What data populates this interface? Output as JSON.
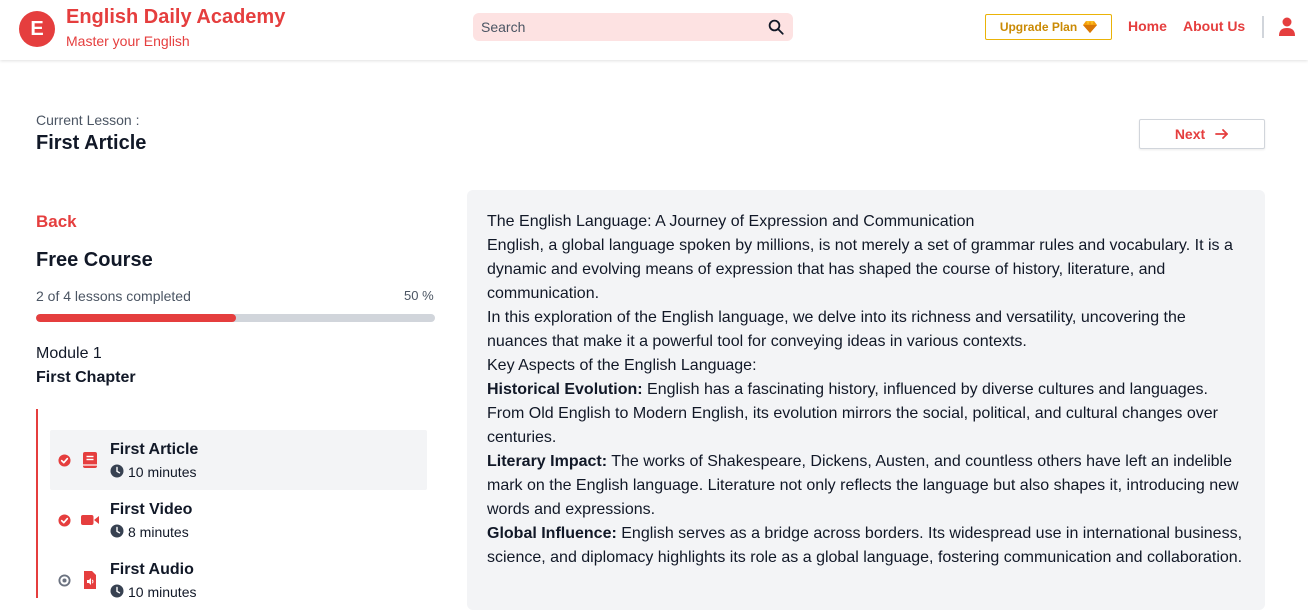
{
  "header": {
    "logo_letter": "E",
    "brand_title": "English Daily Academy",
    "brand_subtitle": "Master your English",
    "search_placeholder": "Search",
    "upgrade_label": "Upgrade Plan",
    "nav": {
      "home": "Home",
      "about": "About Us"
    }
  },
  "lesson_header": {
    "current_label": "Current Lesson :",
    "current_title": "First Article",
    "next_label": "Next"
  },
  "sidebar": {
    "back_label": "Back",
    "course_title": "Free Course",
    "progress_text": "2 of 4 lessons completed",
    "progress_percent_label": "50 %",
    "progress_fraction": 0.5,
    "module_label": "Module 1",
    "chapter_title": "First Chapter",
    "lessons": [
      {
        "title": "First Article",
        "duration": "10 minutes",
        "type": "article",
        "completed": true,
        "active": true
      },
      {
        "title": "First Video",
        "duration": "8 minutes",
        "type": "video",
        "completed": true,
        "active": false
      },
      {
        "title": "First Audio",
        "duration": "10 minutes",
        "type": "audio",
        "completed": false,
        "active": false
      }
    ]
  },
  "article": {
    "title": "The English Language: A Journey of Expression and Communication",
    "intro": "English, a global language spoken by millions, is not merely a set of grammar rules and vocabulary. It is a dynamic and evolving means of expression that has shaped the course of history, literature, and communication.",
    "exploration": "In this exploration of the English language, we delve into its richness and versatility, uncovering the nuances that make it a powerful tool for conveying ideas in various contexts.",
    "key_aspects_heading": "Key Aspects of the English Language:",
    "aspects": [
      {
        "label": "Historical Evolution:",
        "text": " English has a fascinating history, influenced by diverse cultures and languages. From Old English to Modern English, its evolution mirrors the social, political, and cultural changes over centuries."
      },
      {
        "label": "Literary Impact:",
        "text": " The works of Shakespeare, Dickens, Austen, and countless others have left an indelible mark on the English language. Literature not only reflects the language but also shapes it, introducing new words and expressions."
      },
      {
        "label": "Global Influence:",
        "text": " English serves as a bridge across borders. Its widespread use in international business, science, and diplomacy highlights its role as a global language, fostering communication and collaboration."
      }
    ]
  },
  "colors": {
    "accent": "#e53e3e",
    "gold": "#eab308",
    "panel": "#f3f4f6"
  }
}
